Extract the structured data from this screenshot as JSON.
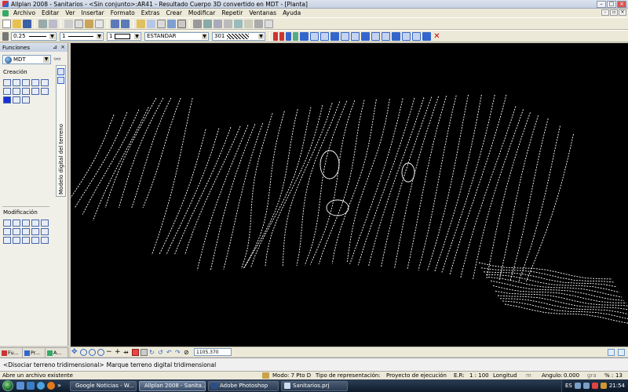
{
  "window": {
    "title": "Allplan 2008 - Sanitarios - <Sin conjunto>:AR41 - Resultado        Cuerpo 3D convertido en MDT - [Planta]"
  },
  "menu": [
    "Archivo",
    "Editar",
    "Ver",
    "Insertar",
    "Formato",
    "Extras",
    "Crear",
    "Modificar",
    "Repetir",
    "Ventanas",
    "Ayuda"
  ],
  "format_bar": {
    "pen_value": "0.25",
    "line_value": "1",
    "color_value": "1",
    "layer_value": "ESTANDAR",
    "hatch_value": "301"
  },
  "palette": {
    "title": "Funciones",
    "module": "MDT",
    "section_create": "Creación",
    "section_modify": "Modificación",
    "vertical_tab": "Modelo digital del terreno",
    "tabs": [
      "Fu...",
      "Pr...",
      "A..."
    ]
  },
  "viewbar": {
    "zoom_value": "1105.370"
  },
  "dialog": {
    "prefix": "<Disociar terreno tridimensional>",
    "text": "Marque terreno digital tridimensional"
  },
  "status": {
    "message": "Abre un archivo existente",
    "mode": "Modo: 7 Pto D",
    "representation_label": "Tipo de representación:",
    "representation_value": "Proyecto de ejecución",
    "scale_label": "E.R:",
    "scale_value": "1 : 100",
    "length_label": "Longitud",
    "length_unit": "m",
    "angle_label": "Angulo:",
    "angle_value": "0.000",
    "angle_unit": "gra",
    "percent_label": "% :",
    "percent_value": "13"
  },
  "taskbar": {
    "tasks": [
      {
        "label": "Google Noticias - W...",
        "active": false
      },
      {
        "label": "Allplan 2008 - Sanita...",
        "active": true
      },
      {
        "label": "Adobe Photoshop",
        "active": false
      },
      {
        "label": "Sanitarios.prj",
        "active": false
      }
    ],
    "language": "ES",
    "clock": "21:54"
  },
  "colors": {
    "viewport_bg": "#000000",
    "contour": "#ffffff",
    "ui_face": "#ece9d8",
    "taskbar": "#1b2a3d"
  }
}
